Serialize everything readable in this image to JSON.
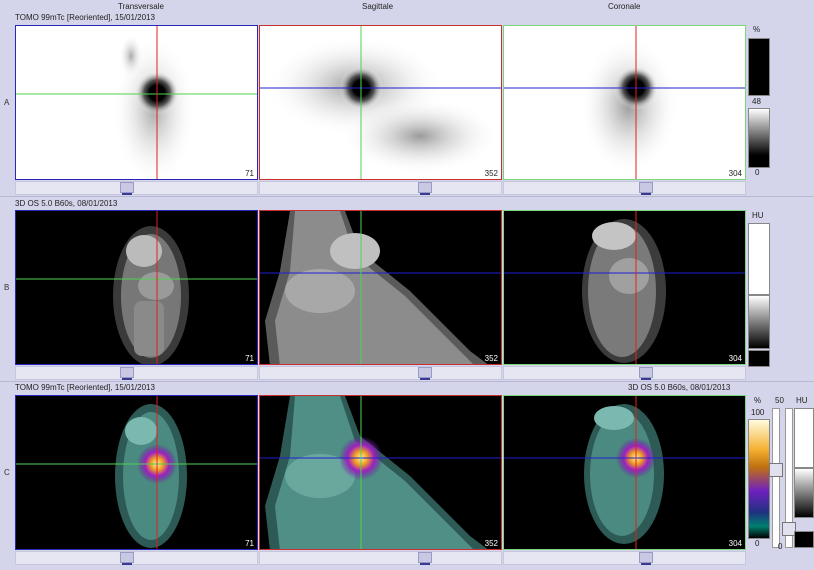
{
  "columns": {
    "transversale": "Transversale",
    "sagittale": "Sagittale",
    "coronale": "Coronale"
  },
  "rows": {
    "a": "A",
    "b": "B",
    "c": "C"
  },
  "series": {
    "tomo_a": "TOMO 99mTc [Reoriented], 15/01/2013",
    "ct_b": "3D  OS  5.0  B60s, 08/01/2013",
    "tomo_c": "TOMO 99mTc [Reoriented], 15/01/2013",
    "ct_c": "3D  OS  5.0  B60s, 08/01/2013"
  },
  "slices": {
    "transversale": "71",
    "sagittale": "352",
    "coronale": "304"
  },
  "scales": {
    "a_unit": "%",
    "a_mid": "48",
    "a_min": "0",
    "b_unit": "HU",
    "c_unit_pct": "%",
    "c_unit_hu": "HU",
    "c_max": "100",
    "c_min": "0",
    "c_window": "50",
    "c_hu_min": "0"
  },
  "colors": {
    "crosshair_green": "#4fd34f",
    "crosshair_red": "#e02020",
    "crosshair_blue": "#2020d0",
    "border_blue": "#2828b8",
    "border_red": "#c83030",
    "border_green": "#7ad67a"
  }
}
